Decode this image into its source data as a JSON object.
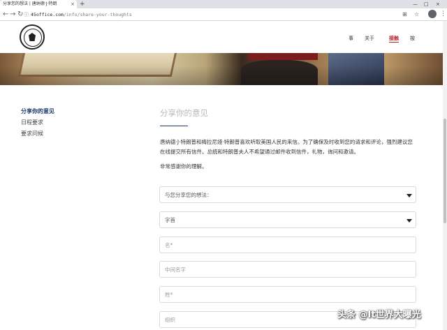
{
  "browser": {
    "tab_title": "分享您的想法 | 唐纳德·J·特朗",
    "tab_close": "×",
    "new_tab": "+",
    "url_domain": "45office.com",
    "url_path": "/info/share-your-thoughts",
    "window_controls": [
      "—",
      "□",
      "×"
    ]
  },
  "site": {
    "nav": [
      "事",
      "关于",
      "接触",
      "按"
    ],
    "active_nav_index": 2
  },
  "sidebar": {
    "items": [
      "分享你的意见",
      "日程要求",
      "要求问候"
    ],
    "active_index": 0
  },
  "main": {
    "title": "分享你的意见",
    "intro": "唐纳德·J·特朗普和梅拉尼娅·特朗普喜欢听取美国人民的来信。为了确保及时收到您的请求和评论，强烈建议您在线提交所有信件。总统和特朗普夫人不希望通过邮件收到信件，礼物，询问和邀请。",
    "thanks": "非常感谢你的理解。",
    "form": {
      "topic_select": "与您分享您的想法：",
      "prefix_select": "字首",
      "first_name_placeholder": "名*",
      "middle_name_placeholder": "中间名字",
      "last_name_placeholder": "姓*",
      "organization_placeholder": "组织"
    }
  },
  "watermark": "头条 @It世界大曝光",
  "colors": {
    "accent_navy": "#1d3a6e",
    "nav_active_red": "#b4232a"
  }
}
